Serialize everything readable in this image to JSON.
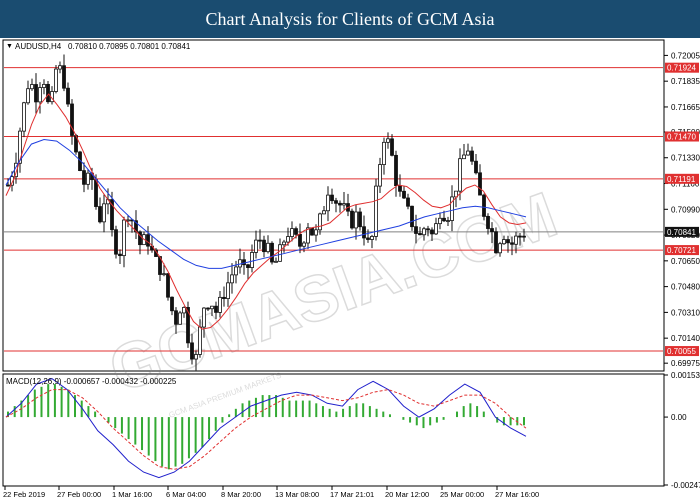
{
  "header": {
    "title": "Chart Analysis for Clients of GCM Asia"
  },
  "watermark": {
    "text": "GCMASIA.COM",
    "small": "GCM ASIA PREMIUM MARKETS"
  },
  "colors": {
    "candle": "#111111",
    "ma_fast": "#e03030",
    "ma_slow": "#2040e0",
    "level_line": "#e03030",
    "current_line": "#808080",
    "macd_hist": "#33aa33",
    "macd_line": "#2020cc",
    "macd_signal": "#e03030",
    "label_bg": "#e03030",
    "current_bg": "#111111"
  },
  "chart_data": [
    {
      "type": "candlestick",
      "symbol_label": "AUDUSD,H4",
      "ohlc_header": "0.70810 0.70895 0.70801 0.70841",
      "y_ticks": [
        "0.72005",
        "0.71835",
        "0.71665",
        "0.71500",
        "0.71330",
        "0.71160",
        "0.70990",
        "0.70820",
        "0.70650",
        "0.70480",
        "0.70310",
        "0.70140",
        "0.69975"
      ],
      "ylim": [
        0.6993,
        0.721
      ],
      "x_labels": [
        "22 Feb 2019",
        "27 Feb 00:00",
        "1 Mar 16:00",
        "6 Mar 04:00",
        "8 Mar 20:00",
        "13 Mar 08:00",
        "17 Mar 21:01",
        "20 Mar 12:00",
        "25 Mar 00:00",
        "27 Mar 16:00"
      ],
      "levels": [
        {
          "value": 0.71924,
          "label": "0.71924"
        },
        {
          "value": 0.7147,
          "label": "0.71470"
        },
        {
          "value": 0.71191,
          "label": "0.71191"
        },
        {
          "value": 0.70721,
          "label": "0.70721"
        },
        {
          "value": 0.70055,
          "label": "0.70055"
        }
      ],
      "current": {
        "value": 0.70841,
        "label": "0.70841"
      },
      "close_path": [
        0.7115,
        0.713,
        0.716,
        0.7185,
        0.7175,
        0.719,
        0.716,
        0.7195,
        0.7185,
        0.715,
        0.713,
        0.7115,
        0.712,
        0.709,
        0.711,
        0.708,
        0.707,
        0.71,
        0.709,
        0.7075,
        0.708,
        0.7065,
        0.706,
        0.704,
        0.7025,
        0.704,
        0.701,
        0.7,
        0.7035,
        0.704,
        0.703,
        0.7045,
        0.7055,
        0.7065,
        0.7055,
        0.707,
        0.708,
        0.7075,
        0.706,
        0.707,
        0.7085,
        0.708,
        0.7075,
        0.709,
        0.708,
        0.7095,
        0.7115,
        0.7105,
        0.71,
        0.709,
        0.7095,
        0.7085,
        0.707,
        0.712,
        0.715,
        0.7135,
        0.711,
        0.71,
        0.709,
        0.708,
        0.709,
        0.708,
        0.71,
        0.7095,
        0.711,
        0.713,
        0.714,
        0.712,
        0.71,
        0.709,
        0.7075,
        0.7085,
        0.7075,
        0.708,
        0.7084
      ],
      "ma_fast": [
        0.7108,
        0.712,
        0.7138,
        0.7155,
        0.7168,
        0.7175,
        0.7168,
        0.716,
        0.715,
        0.7138,
        0.7125,
        0.7113,
        0.7105,
        0.7098,
        0.7092,
        0.7086,
        0.708,
        0.7076,
        0.7068,
        0.7058,
        0.7046,
        0.7035,
        0.7025,
        0.702,
        0.7021,
        0.7026,
        0.7033,
        0.7041,
        0.705,
        0.7057,
        0.7062,
        0.7067,
        0.7071,
        0.7076,
        0.7081,
        0.7085,
        0.7087,
        0.7088,
        0.709,
        0.7095,
        0.71,
        0.7102,
        0.7103,
        0.7104,
        0.7106,
        0.7111,
        0.7115,
        0.7114,
        0.711,
        0.7105,
        0.7101,
        0.71,
        0.7102,
        0.7108,
        0.7113,
        0.7115,
        0.7111,
        0.7102,
        0.7094,
        0.709,
        0.7089,
        0.709
      ],
      "ma_slow": [
        0.7115,
        0.713,
        0.7142,
        0.7145,
        0.7144,
        0.7138,
        0.713,
        0.712,
        0.711,
        0.71,
        0.7092,
        0.7085,
        0.7078,
        0.7072,
        0.7066,
        0.7062,
        0.706,
        0.706,
        0.7062,
        0.7064,
        0.7066,
        0.7068,
        0.707,
        0.7072,
        0.7074,
        0.7076,
        0.7078,
        0.708,
        0.7082,
        0.7084,
        0.7086,
        0.7088,
        0.7091,
        0.7094,
        0.7096,
        0.7098,
        0.71,
        0.7101,
        0.71,
        0.7098,
        0.7096,
        0.7094
      ],
      "legend": []
    },
    {
      "type": "bar+line",
      "label": "MACD(12,26,9) -0.000657 -0.000432 -0.000225",
      "y_ticks": [
        "0.00153",
        "0.00",
        "-0.00247"
      ],
      "ylim": [
        -0.00247,
        0.00153
      ],
      "histogram": [
        0.0002,
        0.0004,
        0.0006,
        0.0008,
        0.001,
        0.0011,
        0.0012,
        0.0012,
        0.0011,
        0.001,
        0.0008,
        0.0006,
        0.0004,
        0.0002,
        0.0,
        -0.0002,
        -0.0004,
        -0.0006,
        -0.0008,
        -0.001,
        -0.0012,
        -0.0014,
        -0.0016,
        -0.0018,
        -0.0019,
        -0.0018,
        -0.0017,
        -0.0015,
        -0.0013,
        -0.0011,
        -0.0008,
        -0.0005,
        -0.0002,
        0.0001,
        0.0003,
        0.0005,
        0.0006,
        0.0007,
        0.0008,
        0.0008,
        0.0008,
        0.0007,
        0.0006,
        0.0006,
        0.0006,
        0.0006,
        0.0005,
        0.0004,
        0.0003,
        0.0002,
        0.0003,
        0.0004,
        0.0005,
        0.0005,
        0.0004,
        0.0003,
        0.0002,
        0.0001,
        0.0,
        -0.0001,
        -0.0002,
        -0.0003,
        -0.0004,
        -0.0003,
        -0.0002,
        -0.0001,
        0.0,
        0.0002,
        0.0004,
        0.0005,
        0.0004,
        0.0002,
        0.0,
        -0.0002,
        -0.0003,
        -0.0003,
        -0.0003,
        -0.0003
      ],
      "macd_line": [
        0.0,
        0.0005,
        0.0012,
        0.0014,
        0.001,
        0.0003,
        -0.0005,
        -0.001,
        -0.0016,
        -0.002,
        -0.0022,
        -0.002,
        -0.0016,
        -0.001,
        -0.0004,
        0.0,
        0.0004,
        0.0006,
        0.0008,
        0.0009,
        0.0008,
        0.0005,
        0.0004,
        0.001,
        0.0013,
        0.001,
        0.0004,
        0.0,
        0.0003,
        0.0008,
        0.0012,
        0.0009,
        0.0,
        -0.0004,
        -0.0007
      ],
      "signal_line": [
        0.0,
        0.0003,
        0.0007,
        0.001,
        0.001,
        0.0007,
        0.0002,
        -0.0004,
        -0.0009,
        -0.0014,
        -0.0018,
        -0.0019,
        -0.0018,
        -0.0014,
        -0.0009,
        -0.0004,
        0.0,
        0.0003,
        0.0006,
        0.0008,
        0.0008,
        0.0007,
        0.0006,
        0.0007,
        0.0009,
        0.001,
        0.0008,
        0.0005,
        0.0004,
        0.0006,
        0.0008,
        0.0008,
        0.0005,
        0.0,
        -0.0004
      ]
    }
  ]
}
